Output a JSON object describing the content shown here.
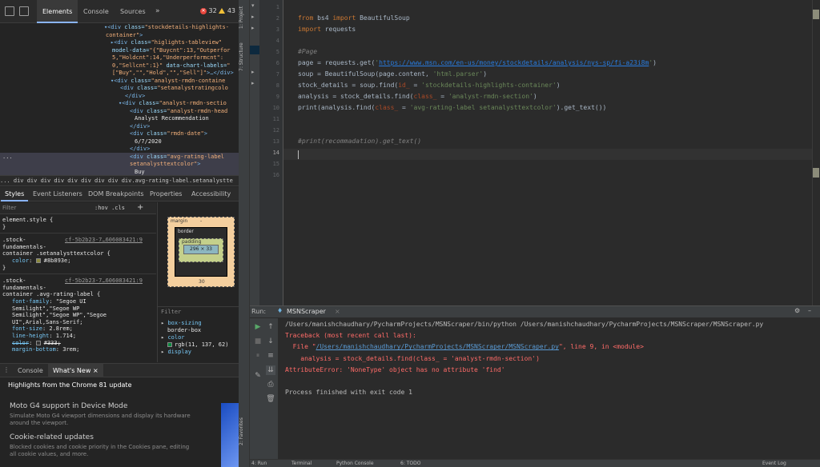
{
  "devtools": {
    "tabs": [
      "Elements",
      "Console",
      "Sources"
    ],
    "more": "»",
    "errors": "32",
    "warnings": "43",
    "dom_lines": [
      {
        "indent": 130,
        "parts": [
          [
            "tag",
            "▾<div "
          ],
          [
            "attr",
            "class="
          ],
          [
            "val",
            "\"stockdetails-highlights-"
          ]
        ]
      },
      {
        "indent": 132,
        "parts": [
          [
            "val",
            "container\""
          ],
          [
            "tag",
            ">"
          ]
        ]
      },
      {
        "indent": 138,
        "parts": [
          [
            "tag",
            "▸<div "
          ],
          [
            "attr",
            "class="
          ],
          [
            "val",
            "\"higlights-tableview\""
          ]
        ]
      },
      {
        "indent": 140,
        "parts": [
          [
            "attr",
            "model-data="
          ],
          [
            "val",
            "\"{\"Buycnt\":13,\"Outperfor"
          ]
        ]
      },
      {
        "indent": 140,
        "parts": [
          [
            "val",
            "5,\"Holdcnt\":14,\"Underperformcnt\":"
          ]
        ]
      },
      {
        "indent": 140,
        "parts": [
          [
            "val",
            "0,\"Sellcnt\":1}\" "
          ],
          [
            "attr",
            "data-chart-labels="
          ],
          [
            "val",
            "\""
          ]
        ]
      },
      {
        "indent": 140,
        "parts": [
          [
            "val",
            "[\"Buy\",\"\",\"Hold\",\"\",\"Sell\"]\""
          ],
          [
            "tag",
            ">…</div>"
          ]
        ]
      },
      {
        "indent": 138,
        "parts": [
          [
            "tag",
            "▾<div "
          ],
          [
            "attr",
            "class="
          ],
          [
            "val",
            "\"analyst-rmdn-containe"
          ]
        ]
      },
      {
        "indent": 150,
        "parts": [
          [
            "tag",
            "<div "
          ],
          [
            "attr",
            "class="
          ],
          [
            "val",
            "\"setanalystratingcolo"
          ]
        ]
      },
      {
        "indent": 156,
        "parts": [
          [
            "tag",
            "</div>"
          ]
        ]
      },
      {
        "indent": 148,
        "parts": [
          [
            "tag",
            "▾<div "
          ],
          [
            "attr",
            "class="
          ],
          [
            "val",
            "\"analyst-rmdn-sectio"
          ]
        ]
      },
      {
        "indent": 162,
        "parts": [
          [
            "tag",
            "<div "
          ],
          [
            "attr",
            "class="
          ],
          [
            "val",
            "\"analyst-rmdn-head"
          ]
        ]
      },
      {
        "indent": 168,
        "parts": [
          [
            "txt",
            "Analyst Recommendation"
          ]
        ]
      },
      {
        "indent": 162,
        "parts": [
          [
            "tag",
            "</div>"
          ]
        ]
      },
      {
        "indent": 162,
        "parts": [
          [
            "tag",
            "<div "
          ],
          [
            "attr",
            "class="
          ],
          [
            "val",
            "\"rmdn-date\""
          ],
          [
            "tag",
            ">"
          ]
        ]
      },
      {
        "indent": 168,
        "parts": [
          [
            "txt",
            "6/7/2020"
          ]
        ]
      },
      {
        "indent": 162,
        "parts": [
          [
            "tag",
            "</div>"
          ]
        ]
      },
      {
        "indent": 162,
        "parts": [
          [
            "tag",
            "<div "
          ],
          [
            "attr",
            "class="
          ],
          [
            "val",
            "\"avg-rating-label"
          ]
        ],
        "selected": true
      },
      {
        "indent": 162,
        "parts": [
          [
            "val",
            "setanalysttextcolor\""
          ],
          [
            "tag",
            ">"
          ]
        ],
        "selected": true
      },
      {
        "indent": 168,
        "parts": [
          [
            "txt",
            "Buy"
          ]
        ],
        "selected": true
      }
    ],
    "dom_ellipsis": "...",
    "breadcrumb": "...  div  div  div  div  div  div  div  div  div.avg-rating-label.setanalystte",
    "sub_tabs": [
      "Styles",
      "Event Listeners",
      "DOM Breakpoints",
      "Properties",
      "Accessibility"
    ],
    "filter_placeholder": "Filter",
    "hov_cls": ":hov  .cls",
    "plus": "+",
    "styles_lines": [
      {
        "kind": "sel",
        "text": "element.style {"
      },
      {
        "kind": "sel",
        "text": "}"
      },
      {
        "kind": "sep"
      },
      {
        "kind": "selsrc",
        "text": ".stock-",
        "src": "cf-5b2b23-7…606083421:9"
      },
      {
        "kind": "sel",
        "text": "fundamentals-"
      },
      {
        "kind": "sel",
        "text": "container .setanalysttextcolor {"
      },
      {
        "kind": "propcolor",
        "prop": "color",
        "value": "#8b893e;",
        "swatch": "#8b893e"
      },
      {
        "kind": "sel",
        "text": "}"
      },
      {
        "kind": "sep"
      },
      {
        "kind": "selsrc",
        "text": ".stock-",
        "src": "cf-5b2b23-7…606083421:9"
      },
      {
        "kind": "sel",
        "text": "fundamentals-"
      },
      {
        "kind": "sel",
        "text": "container .avg-rating-label {"
      },
      {
        "kind": "prop",
        "prop": "font-family",
        "value": "\"Segoe UI"
      },
      {
        "kind": "cont",
        "text": "Semilight\",\"Segoe WP"
      },
      {
        "kind": "cont",
        "text": "Semilight\",\"Segoe WP\",\"Segoe"
      },
      {
        "kind": "cont",
        "text": "UI\",Arial,Sans-Serif;"
      },
      {
        "kind": "prop",
        "prop": "font-size",
        "value": "2.8rem;"
      },
      {
        "kind": "prop",
        "prop": "line-height",
        "value": "1.714;"
      },
      {
        "kind": "propcolor",
        "prop": "color",
        "value": "#333;",
        "swatch": "#333333",
        "struck": true
      },
      {
        "kind": "prop",
        "prop": "margin-bottom",
        "value": "3rem;"
      }
    ],
    "box_model": {
      "margin": "margin",
      "border": "border",
      "padding": "padding",
      "content": "296 × 33",
      "dash": "-",
      "bottom": "30"
    },
    "computed_filter": "Filter",
    "computed_lines": [
      {
        "arrow": true,
        "prop": "box-sizing",
        "value": ""
      },
      {
        "arrow": false,
        "prop": "",
        "value": "border-box"
      },
      {
        "arrow": true,
        "prop": "color",
        "value": ""
      },
      {
        "arrow": false,
        "prop": "",
        "value": "rgb(11, 137, 62)",
        "swatch": "#0b893e"
      },
      {
        "arrow": true,
        "prop": "display",
        "value": ""
      }
    ],
    "drawer_tabs": [
      "Console",
      "What's New"
    ],
    "drawer_close": "×",
    "whats_new": {
      "title": "Highlights from the Chrome 81 update",
      "items": [
        {
          "heading": "Moto G4 support in Device Mode",
          "desc": "Simulate Moto G4 viewport dimensions and display its hardware around the viewport."
        },
        {
          "heading": "Cookie-related updates",
          "desc": "Blocked cookies and cookie priority in the Cookies pane, editing all cookie values, and more."
        }
      ]
    }
  },
  "ide": {
    "side_labels": {
      "project": "1: Project",
      "structure": "7: Structure",
      "favorites": "2: Favorites"
    },
    "line_numbers": [
      "1",
      "2",
      "3",
      "4",
      "5",
      "6",
      "7",
      "8",
      "9",
      "10",
      "11",
      "12",
      "13",
      "14",
      "15",
      "16"
    ],
    "current_line": "14",
    "code_lines": [
      [],
      [
        [
          "kw",
          "from "
        ],
        [
          "plain",
          "bs4 "
        ],
        [
          "kw",
          "import "
        ],
        [
          "plain",
          "BeautifulSoup"
        ]
      ],
      [
        [
          "kw",
          "import "
        ],
        [
          "plain",
          "requests"
        ]
      ],
      [],
      [
        [
          "comment",
          "#Page"
        ]
      ],
      [
        [
          "plain",
          "page = requests.get("
        ],
        [
          "str",
          "'"
        ],
        [
          "url",
          "https://www.msn.com/en-us/money/stockdetails/analysis/nys-sp/fi-a23i8m"
        ],
        [
          "str",
          "'"
        ],
        [
          "plain",
          ")"
        ]
      ],
      [
        [
          "plain",
          "soup = BeautifulSoup(page.content, "
        ],
        [
          "str",
          "'html.parser'"
        ],
        [
          "plain",
          ")"
        ]
      ],
      [
        [
          "plain",
          "stock_details = soup.find("
        ],
        [
          "kwarg",
          "id_"
        ],
        [
          "plain",
          " = "
        ],
        [
          "str",
          "'stockdetails-highlights-container'"
        ],
        [
          "plain",
          ")"
        ]
      ],
      [
        [
          "plain",
          "analysis = stock_details.find("
        ],
        [
          "kwarg",
          "class_"
        ],
        [
          "plain",
          " = "
        ],
        [
          "str",
          "'analyst-rmdn-section'"
        ],
        [
          "plain",
          ")"
        ]
      ],
      [
        [
          "plain",
          "print(analysis.find("
        ],
        [
          "kwarg",
          "class_"
        ],
        [
          "plain",
          " = "
        ],
        [
          "str",
          "'avg-rating-label setanalysttextcolor'"
        ],
        [
          "plain",
          ").get_text())"
        ]
      ],
      [],
      [],
      [
        [
          "comment",
          "#print(recommadation).get_text()"
        ]
      ],
      [],
      [],
      []
    ],
    "run": {
      "label": "Run:",
      "config": "MSNScraper",
      "close": "×",
      "gear": "⚙",
      "minimize": "–",
      "console_lines": [
        {
          "cls": "c-path",
          "text": "/Users/manishchaudhary/PycharmProjects/MSNScraper/bin/python /Users/manishchaudhary/PycharmProjects/MSNScraper/MSNScraper.py"
        },
        {
          "cls": "c-err",
          "text": "Traceback (most recent call last):"
        },
        {
          "cls": "c-err",
          "text": "  File \"",
          "link": "/Users/manishchaudhary/PycharmProjects/MSNScraper/MSNScraper.py",
          "after": "\", line 9, in <module>"
        },
        {
          "cls": "c-err",
          "text": "    analysis = stock_details.find(class_ = 'analyst-rmdn-section')"
        },
        {
          "cls": "c-err",
          "text": "AttributeError: 'NoneType' object has no attribute 'find'"
        },
        {
          "cls": "c-ok",
          "text": ""
        },
        {
          "cls": "c-ok",
          "text": "Process finished with exit code 1"
        }
      ]
    },
    "bottom_tabs": [
      "4: Run",
      "Terminal",
      "Python Console",
      "6: TODO",
      "Event Log"
    ]
  }
}
